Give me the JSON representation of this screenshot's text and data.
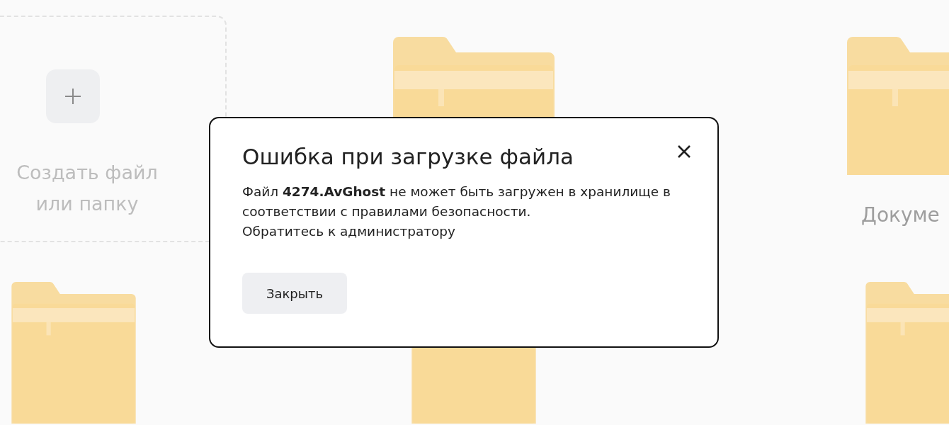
{
  "grid": [
    {
      "kind": "create",
      "label": "Создать файл или папку"
    },
    {
      "kind": "folder"
    },
    {
      "kind": "folder",
      "label": "Докуме"
    },
    {
      "kind": "folder"
    },
    {
      "kind": "folder"
    },
    {
      "kind": "folder"
    }
  ],
  "dialog": {
    "title": "Ошибка при загрузке файла",
    "paragraphs": [
      "Файл **4274.AvGhost** не может быть загружен в хранилище в соответствии с правилами безопасности.",
      "Обратитесь к администратору"
    ],
    "button": "Закрыть"
  }
}
